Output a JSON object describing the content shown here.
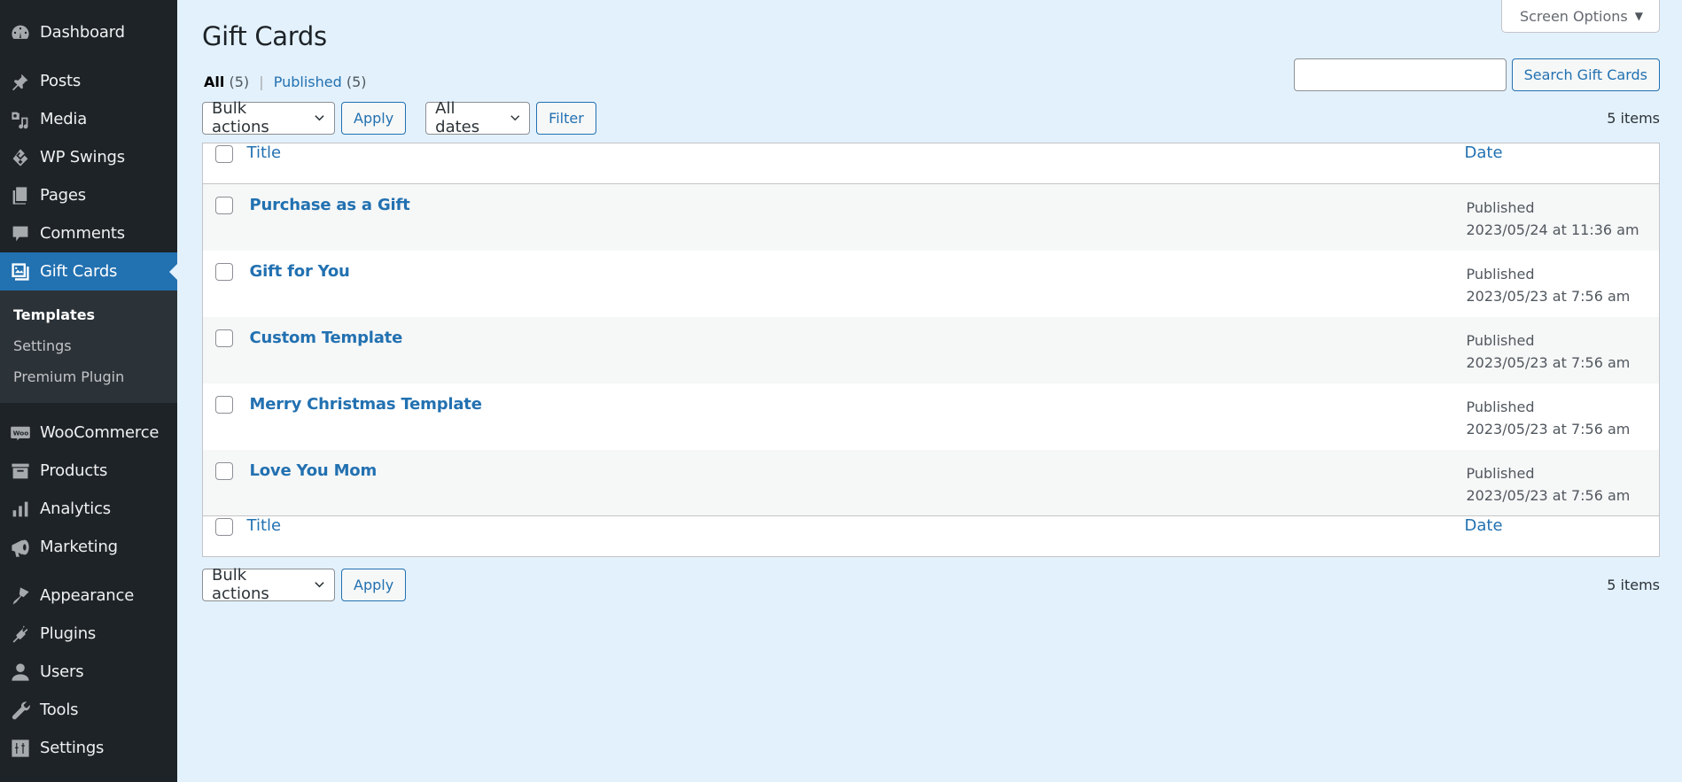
{
  "sidebar": {
    "items": [
      {
        "id": "dashboard",
        "label": "Dashboard",
        "icon": "dashboard-icon"
      },
      {
        "id": "posts",
        "label": "Posts",
        "icon": "pin-icon"
      },
      {
        "id": "media",
        "label": "Media",
        "icon": "media-icon"
      },
      {
        "id": "wp-swings",
        "label": "WP Swings",
        "icon": "wp-swings-icon"
      },
      {
        "id": "pages",
        "label": "Pages",
        "icon": "pages-icon"
      },
      {
        "id": "comments",
        "label": "Comments",
        "icon": "comment-icon"
      },
      {
        "id": "gift-cards",
        "label": "Gift Cards",
        "icon": "gift-cards-icon",
        "active": true
      },
      {
        "id": "woocommerce",
        "label": "WooCommerce",
        "icon": "woo-icon"
      },
      {
        "id": "products",
        "label": "Products",
        "icon": "archive-icon"
      },
      {
        "id": "analytics",
        "label": "Analytics",
        "icon": "bar-chart-icon"
      },
      {
        "id": "marketing",
        "label": "Marketing",
        "icon": "megaphone-icon"
      },
      {
        "id": "appearance",
        "label": "Appearance",
        "icon": "paintbrush-icon"
      },
      {
        "id": "plugins",
        "label": "Plugins",
        "icon": "plug-icon"
      },
      {
        "id": "users",
        "label": "Users",
        "icon": "user-icon"
      },
      {
        "id": "tools",
        "label": "Tools",
        "icon": "wrench-icon"
      },
      {
        "id": "settings",
        "label": "Settings",
        "icon": "sliders-icon"
      }
    ],
    "submenu": [
      {
        "label": "Templates",
        "current": true
      },
      {
        "label": "Settings"
      },
      {
        "label": "Premium Plugin"
      }
    ]
  },
  "header": {
    "screen_options": "Screen Options",
    "title": "Gift Cards"
  },
  "views": {
    "all_label": "All",
    "all_count": "(5)",
    "separator": "|",
    "published_label": "Published",
    "published_count": "(5)"
  },
  "search": {
    "value": "",
    "placeholder": "",
    "button": "Search Gift Cards"
  },
  "tablenav_top": {
    "bulk_actions": "Bulk actions",
    "apply": "Apply",
    "dates": "All dates",
    "filter": "Filter",
    "count": "5 items"
  },
  "table": {
    "columns": {
      "title": "Title",
      "date": "Date"
    },
    "rows": [
      {
        "title": "Purchase as a Gift",
        "status": "Published",
        "date": "2023/05/24 at 11:36 am"
      },
      {
        "title": "Gift for You",
        "status": "Published",
        "date": "2023/05/23 at 7:56 am"
      },
      {
        "title": "Custom Template",
        "status": "Published",
        "date": "2023/05/23 at 7:56 am"
      },
      {
        "title": "Merry Christmas Template",
        "status": "Published",
        "date": "2023/05/23 at 7:56 am"
      },
      {
        "title": "Love You Mom",
        "status": "Published",
        "date": "2023/05/23 at 7:56 am"
      }
    ]
  },
  "tablenav_bottom": {
    "bulk_actions": "Bulk actions",
    "apply": "Apply",
    "count": "5 items"
  },
  "colors": {
    "accent": "#2271b1",
    "sidebar_bg": "#1d2327",
    "submenu_bg": "#2c3338",
    "page_bg": "#e3f1fc"
  }
}
